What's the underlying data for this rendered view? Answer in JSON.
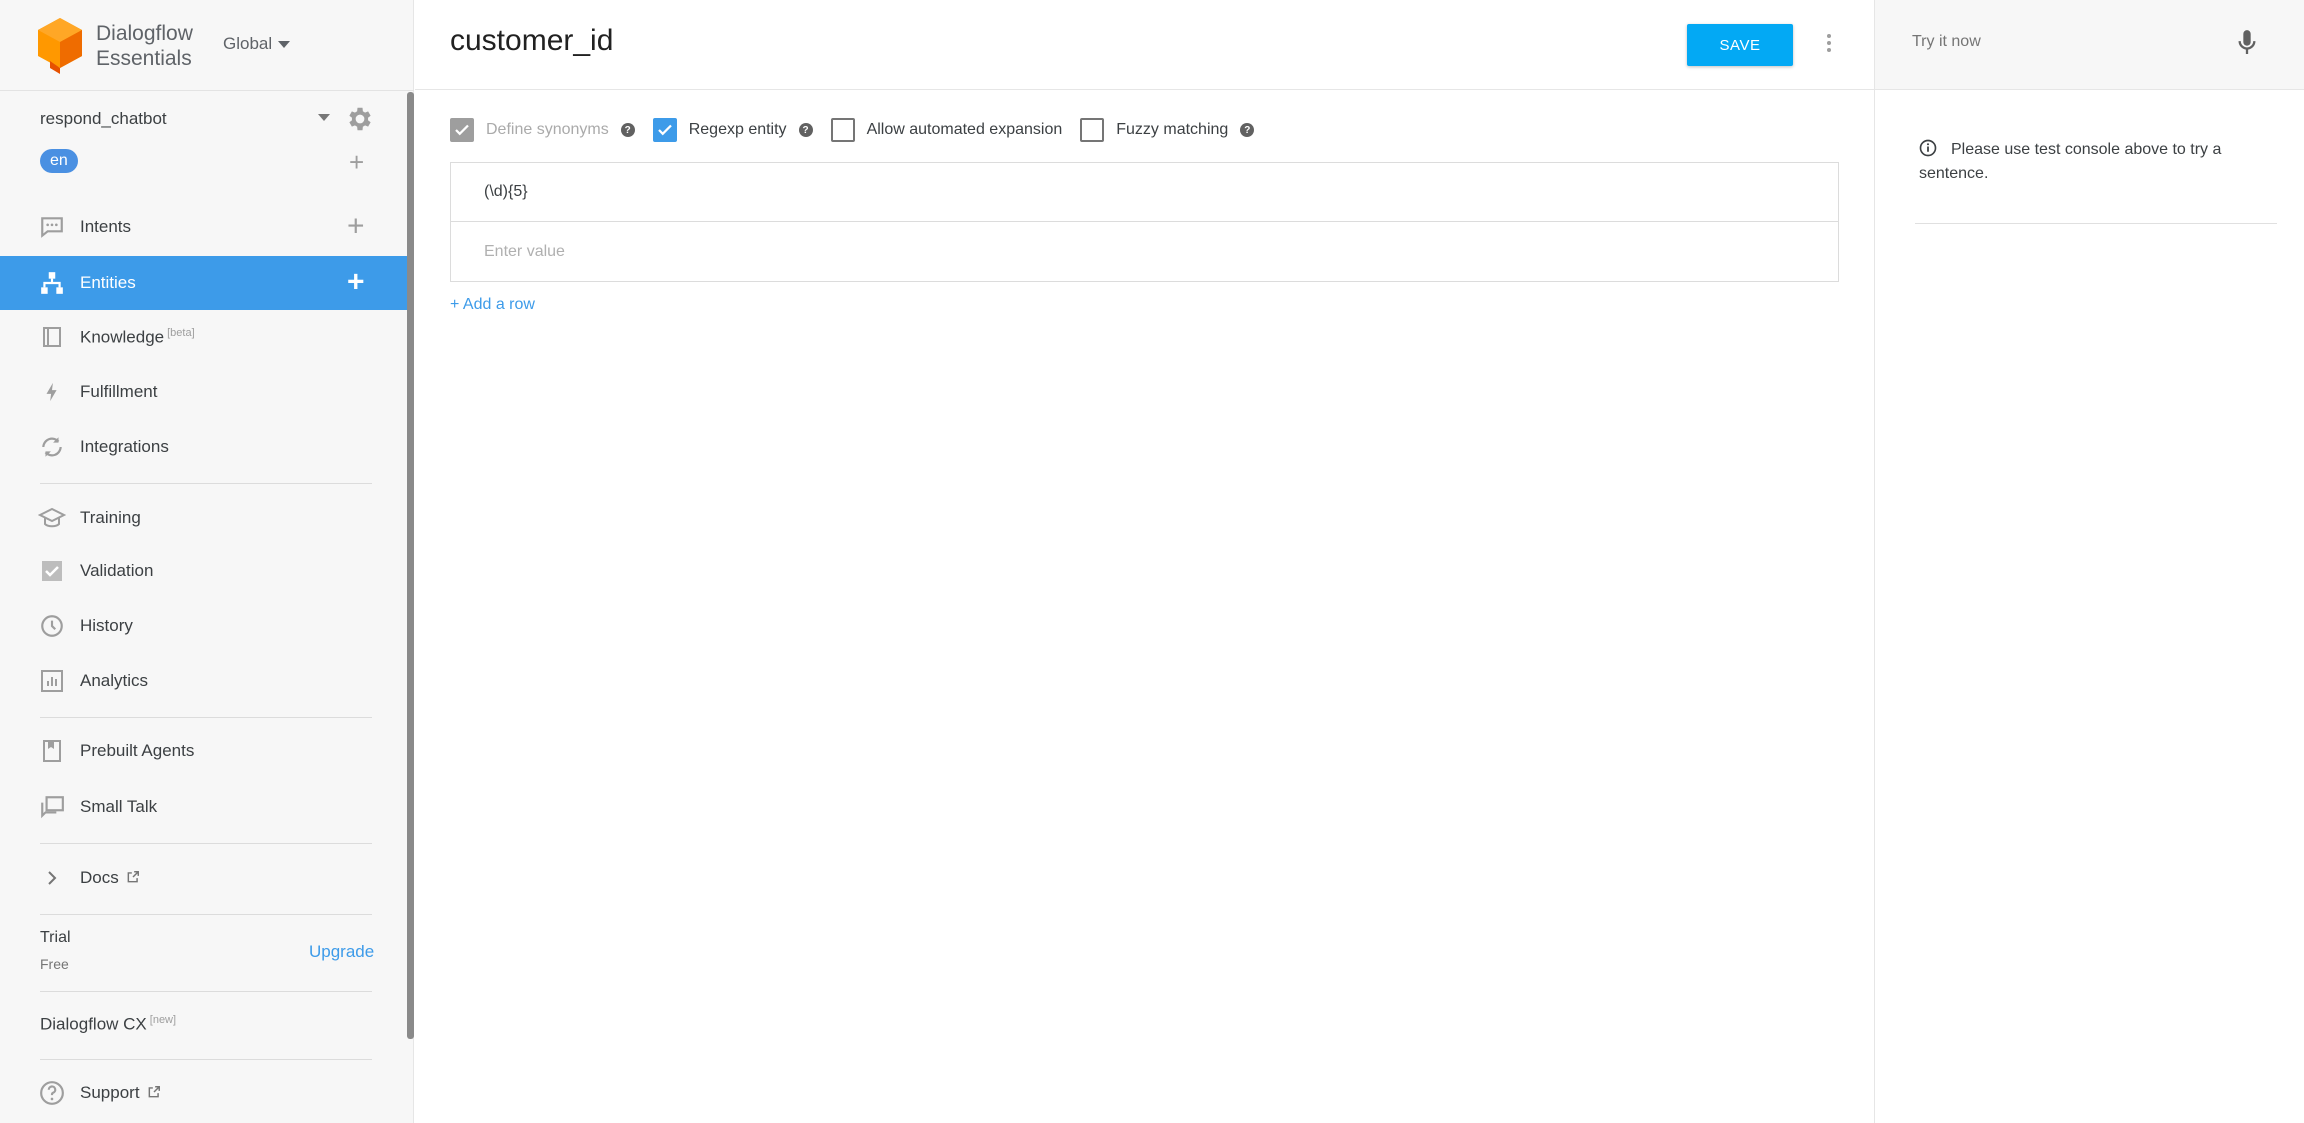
{
  "brand": {
    "line1": "Dialogflow",
    "line2": "Essentials",
    "region": "Global"
  },
  "agent": {
    "name": "respond_chatbot",
    "language": "en"
  },
  "nav": {
    "intents": "Intents",
    "entities": "Entities",
    "knowledge": "Knowledge",
    "knowledge_badge": "[beta]",
    "fulfillment": "Fulfillment",
    "integrations": "Integrations",
    "training": "Training",
    "validation": "Validation",
    "history": "History",
    "analytics": "Analytics",
    "prebuilt_agents": "Prebuilt Agents",
    "small_talk": "Small Talk",
    "docs": "Docs",
    "support": "Support"
  },
  "plan": {
    "name": "Trial",
    "tier": "Free",
    "upgrade": "Upgrade"
  },
  "cx": {
    "label": "Dialogflow CX",
    "badge": "[new]"
  },
  "entity": {
    "name": "customer_id",
    "save": "SAVE",
    "options": [
      {
        "label": "Define synonyms",
        "checked": true,
        "disabled": true
      },
      {
        "label": "Regexp entity",
        "checked": true,
        "disabled": false
      },
      {
        "label": "Allow automated expansion",
        "checked": false,
        "disabled": false
      },
      {
        "label": "Fuzzy matching",
        "checked": false,
        "disabled": false
      }
    ],
    "rows": [
      "(\\d){5}"
    ],
    "new_row_placeholder": "Enter value",
    "add_row": "+ Add a row"
  },
  "console": {
    "placeholder": "Try it now",
    "notice": "Please use test console above to try a sentence."
  },
  "colors": {
    "accent": "#3d9be9",
    "save": "#03a9f4",
    "logo": "#f57c00"
  }
}
